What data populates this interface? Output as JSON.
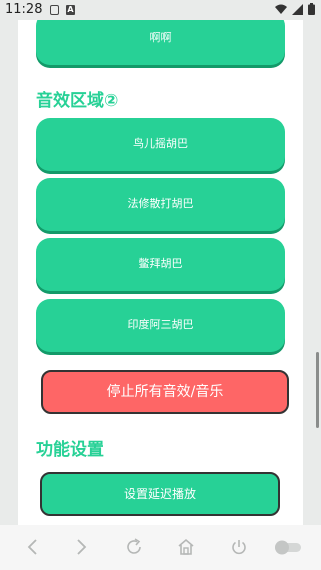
{
  "status_bar": {
    "time": "11:28",
    "notification_icons": [
      "media-icon",
      "text-app-icon"
    ],
    "text_app_letter": "A"
  },
  "sound_zone": {
    "top_button_label": "啊啊",
    "section2_title": "音效区域②",
    "buttons": [
      "鸟儿摇胡巴",
      "法修散打胡巴",
      "鳖拜胡巴",
      "印度阿三胡巴"
    ]
  },
  "stop_button_label": "停止所有音效/音乐",
  "settings": {
    "title": "功能设置",
    "delay_button_label": "设置延迟播放"
  },
  "colors": {
    "accent_green": "#27d196",
    "stop_red": "#fe6666"
  },
  "bottom_nav": {
    "items": [
      "back-icon",
      "forward-icon",
      "refresh-icon",
      "home-icon",
      "power-icon",
      "toggle-switch"
    ]
  }
}
